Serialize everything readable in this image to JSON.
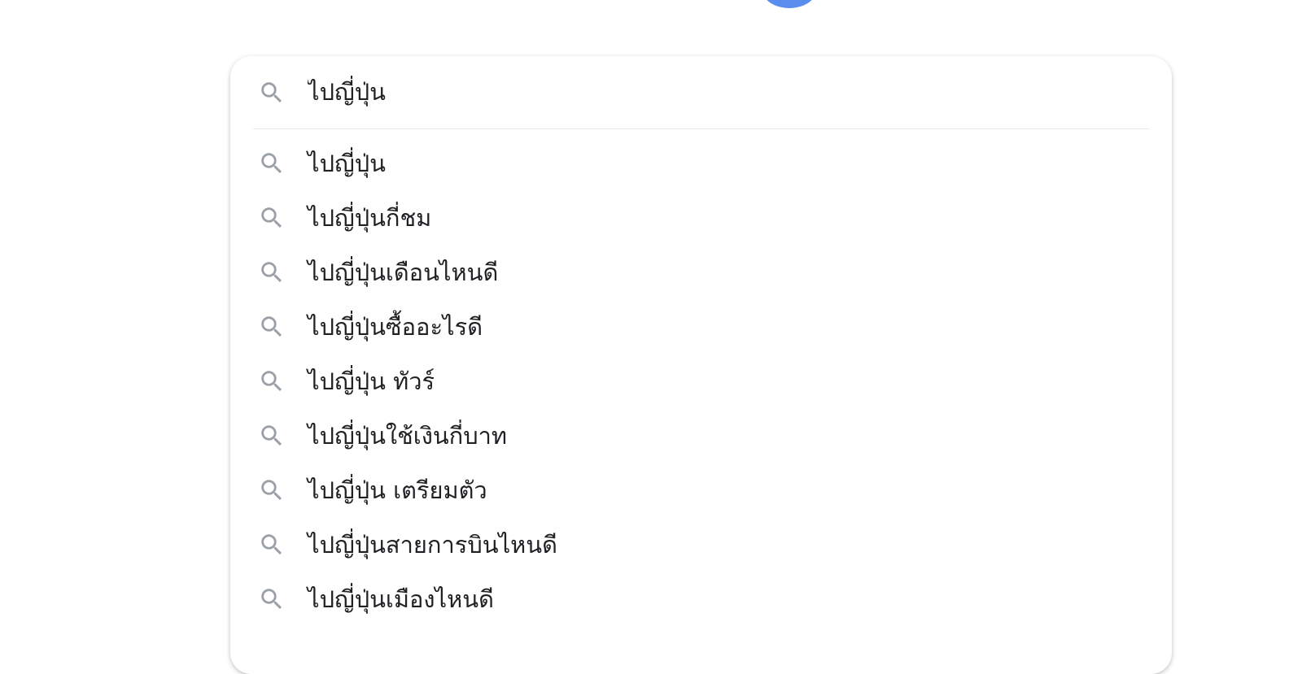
{
  "search": {
    "value": "ไปญี่ปุ่น",
    "icon": "search-icon"
  },
  "colors": {
    "logo_blue": "#5b8def",
    "text": "#202124",
    "icon_gray": "#9aa0a6"
  },
  "suggestions": [
    {
      "label": "ไปญี่ปุ่น",
      "icon": "search-icon"
    },
    {
      "label": "ไปญี่ปุ่นกี่ชม",
      "icon": "search-icon"
    },
    {
      "label": "ไปญี่ปุ่นเดือนไหนดี",
      "icon": "search-icon"
    },
    {
      "label": "ไปญี่ปุ่นซื้ออะไรดี",
      "icon": "search-icon"
    },
    {
      "label": "ไปญี่ปุ่น ทัวร์",
      "icon": "search-icon"
    },
    {
      "label": "ไปญี่ปุ่นใช้เงินกี่บาท",
      "icon": "search-icon"
    },
    {
      "label": "ไปญี่ปุ่น เตรียมตัว",
      "icon": "search-icon"
    },
    {
      "label": "ไปญี่ปุ่นสายการบินไหนดี",
      "icon": "search-icon"
    },
    {
      "label": "ไปญี่ปุ่นเมืองไหนดี",
      "icon": "search-icon"
    }
  ]
}
